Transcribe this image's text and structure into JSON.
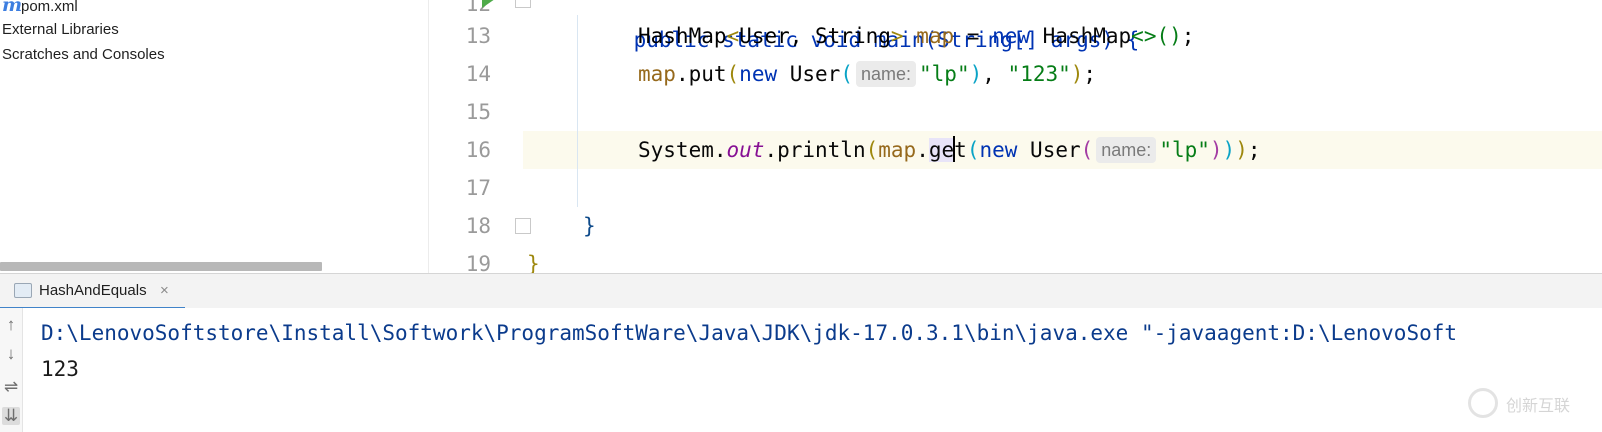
{
  "sidebar": {
    "items": [
      {
        "label": "pom.xml",
        "icon": "maven-icon"
      },
      {
        "label": "External Libraries"
      },
      {
        "label": "Scratches and Consoles"
      }
    ]
  },
  "editor": {
    "line_numbers": [
      "12",
      "13",
      "14",
      "15",
      "16",
      "17",
      "18",
      "19"
    ],
    "current_line": "16",
    "lines": {
      "l12_a": "public static void main(String[] args) {",
      "l13_type": "HashMap",
      "l13_lt": "<",
      "l13_generics": "User, String",
      "l13_gt": ">",
      "l13_var": "map",
      "l13_eq": " = ",
      "l13_new": "new",
      "l13_ctor": " HashMap",
      "l13_diamond": "<>",
      "l13_paren": "()",
      "l13_semi": ";",
      "l14_var": "map",
      "l14_put": ".put",
      "l14_open": "(",
      "l14_new": "new",
      "l14_user": " User",
      "l14_open2": "(",
      "l14_hint": "name:",
      "l14_str1": "\"lp\"",
      "l14_close2": ")",
      "l14_comma": ", ",
      "l14_str2": "\"123\"",
      "l14_close": ")",
      "l14_semi": ";",
      "l16_system": "System.",
      "l16_out": "out",
      "l16_println": ".println",
      "l16_open": "(",
      "l16_map": "map",
      "l16_dot": ".",
      "l16_ge": "ge",
      "l16_t": "t",
      "l16_open2": "(",
      "l16_new": "new",
      "l16_user": " User",
      "l16_open3": "(",
      "l16_hint": "name:",
      "l16_str": "\"lp\"",
      "l16_close3": ")",
      "l16_close2": ")",
      "l16_close": ")",
      "l16_semi": ";",
      "l18_brace": "}",
      "l19_brace": "}"
    }
  },
  "run": {
    "tab_label": "HashAndEquals",
    "tab_close": "×",
    "command": "D:\\LenovoSoftstore\\Install\\Softwork\\ProgramSoftWare\\Java\\JDK\\jdk-17.0.3.1\\bin\\java.exe \"-javaagent:D:\\LenovoSoft",
    "output": "123",
    "toolbar": [
      {
        "icon": "arrow-up-icon",
        "glyph": "↑"
      },
      {
        "icon": "arrow-down-icon",
        "glyph": "↓"
      },
      {
        "icon": "soft-wrap-icon",
        "glyph": "⇌"
      },
      {
        "icon": "scroll-to-end-icon",
        "glyph": "⇊"
      }
    ]
  },
  "watermark": {
    "text": "创新互联"
  },
  "colors": {
    "keyword": "#0033b3",
    "string": "#067d17",
    "static_field": "#871094",
    "local_var": "#96691c",
    "current_line_bg": "#fcfaed",
    "active_tab_underline": "#4083c9"
  }
}
